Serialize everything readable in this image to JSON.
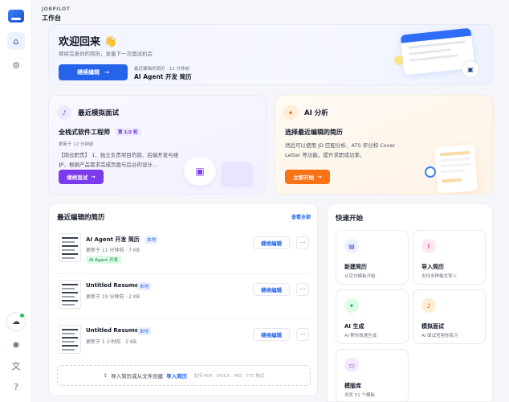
{
  "brand": "JOBPILOT",
  "breadcrumb": "工作台",
  "welcome": {
    "title": "欢迎回来 👋",
    "subtitle": "继续完善你的简历，准备下一次面试机会",
    "continue_label": "继续编辑",
    "recent_label": "最近编辑的简历 · 11 分钟前",
    "recent_title": "AI Agent 开发 简历"
  },
  "interview": {
    "header": "最近模拟面试",
    "role": "全栈式软件工程师",
    "round": "第 1/2 轮",
    "updated": "更新于 12 分钟前",
    "description": "【岗位职责】 1、独立负责项目的前、后端开发与维护，根据产品需求完成页面与后台的设计…",
    "button": "继续面试"
  },
  "analysis": {
    "header": "AI 分析",
    "title": "选择最近编辑的简历",
    "description": "然后可以使用 JD 匹配分析、ATS 评分和 Cover Letter 等功能，提升求职成功率。",
    "button": "立即开始"
  },
  "recent": {
    "header": "最近编辑的简历",
    "view_all": "查看全部",
    "local_tag": "本地",
    "edit_label": "继续编辑",
    "more_label": "···",
    "items": [
      {
        "name": "AI Agent 开发 简历",
        "meta": "更新于 11 分钟前  ·  7 KB",
        "tag": "AI Agent 开发"
      },
      {
        "name": "Untitled Resume",
        "meta": "更新于 19 分钟前  ·  2 KB"
      },
      {
        "name": "Untitled Resume",
        "meta": "更新于 1 小时前  ·  2 KB"
      }
    ],
    "import_text": "导入简历或从文件创建",
    "import_link": "导入简历",
    "import_hint": "支持 PDF、DOCX、MD、TXT 格式"
  },
  "quick": {
    "header": "快速开始",
    "tiles": [
      {
        "title": "新建简历",
        "desc": "从空白模板开始",
        "icon": "document-icon",
        "color": "#eef2ff",
        "fg": "#4f46e5"
      },
      {
        "title": "导入简历",
        "desc": "支持多种格式导入",
        "icon": "upload-icon",
        "color": "#fce7f3",
        "fg": "#db2777"
      },
      {
        "title": "AI 生成",
        "desc": "AI 帮你快速生成",
        "icon": "sparkle-icon",
        "color": "#dcfce7",
        "fg": "#16a34a"
      },
      {
        "title": "模拟面试",
        "desc": "AI 面试官陪你练习",
        "icon": "microphone-icon",
        "color": "#ffedd5",
        "fg": "#ea580c"
      },
      {
        "title": "模版库",
        "desc": "浏览 51 个模板",
        "icon": "folder-icon",
        "color": "#f3e8ff",
        "fg": "#9333ea"
      }
    ]
  },
  "colors": {
    "primary": "#2563eb",
    "purple": "#7c3aed",
    "orange": "#f97316"
  }
}
